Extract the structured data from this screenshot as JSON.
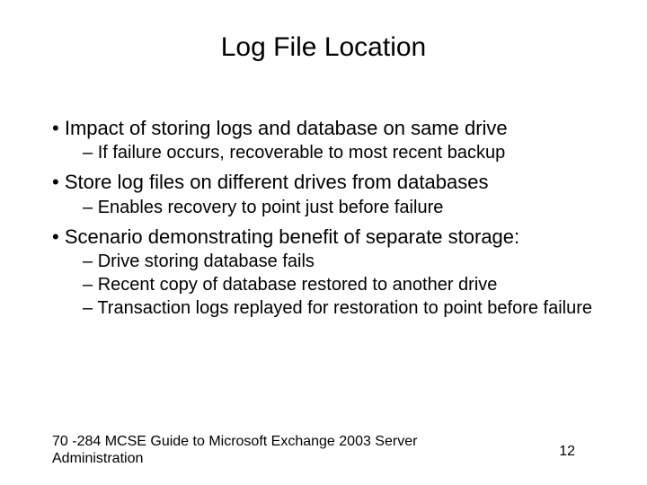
{
  "title": "Log File Location",
  "bullets": {
    "b1a": "Impact of storing logs and database on same drive",
    "b1a_sub1": "If failure occurs, recoverable to most recent backup",
    "b1b": "Store log files on different drives from databases",
    "b1b_sub1": "Enables recovery to point just before failure",
    "b1c": "Scenario demonstrating benefit of separate storage:",
    "b1c_sub1": "Drive storing database fails",
    "b1c_sub2": "Recent copy of database restored to another drive",
    "b1c_sub3": "Transaction logs replayed for restoration to point before failure"
  },
  "footer": "70 -284 MCSE Guide to Microsoft Exchange 2003 Server Administration",
  "page_number": "12"
}
